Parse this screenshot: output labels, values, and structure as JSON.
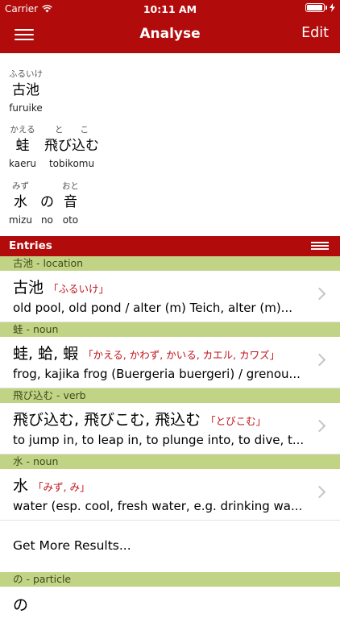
{
  "status_bar": {
    "carrier": "Carrier",
    "time": "10:11 AM",
    "battery_level": 0.95
  },
  "nav": {
    "title": "Analyse",
    "edit_label": "Edit"
  },
  "analysis": {
    "lines": [
      {
        "words": [
          {
            "reading": "ふるいけ",
            "kanji": "古池",
            "romaji": "furuike"
          }
        ]
      },
      {
        "words": [
          {
            "reading": "かえる",
            "kanji": "蛙",
            "romaji": "kaeru"
          },
          {
            "reading": "と　　こ",
            "kanji": "飛び込む",
            "romaji": "tobikomu"
          }
        ]
      },
      {
        "words": [
          {
            "reading": "みず",
            "kanji": "水",
            "romaji": "mizu"
          },
          {
            "reading": "",
            "kanji": "の",
            "romaji": "no"
          },
          {
            "reading": "おと",
            "kanji": "音",
            "romaji": "oto"
          }
        ]
      }
    ]
  },
  "entries_label": "Entries",
  "sections": [
    {
      "header": "古池 - location",
      "headword": "古池",
      "reading": "「ふるいけ」",
      "gloss": "old pool, old pond / alter (m) Teich, alter (m)..."
    },
    {
      "header": "蛙 - noun",
      "headword": "蛙, 蛤, 蝦",
      "reading": "「かえる, かわず, かいる, カエル, カワズ」",
      "gloss": "frog, kajika frog (Buergeria buergeri) / grenou..."
    },
    {
      "header": "飛び込む - verb",
      "headword": "飛び込む, 飛びこむ, 飛込む",
      "reading": "「とびこむ」",
      "gloss": "to jump in, to leap in, to plunge into, to dive, t..."
    },
    {
      "header": "水 - noun",
      "headword": "水",
      "reading": "「みず, み」",
      "gloss": "water (esp. cool, fresh water, e.g. drinking wa..."
    }
  ],
  "more_results_label": "Get More Results...",
  "particle_section": {
    "header": "の - particle",
    "headword": "の"
  },
  "colors": {
    "brand_red": "#b20b0b",
    "section_green": "#c1d384",
    "reading_red": "#c0141c"
  }
}
